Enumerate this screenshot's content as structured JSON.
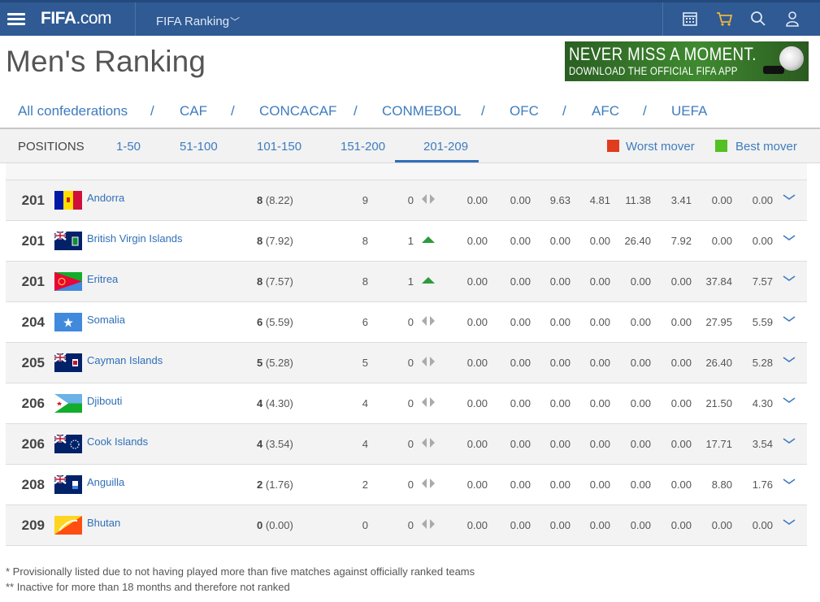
{
  "header": {
    "logo_main": "FIFA",
    "logo_suffix": ".com",
    "nav_title": "FIFA Ranking",
    "nav_chevron": "﹀"
  },
  "page_title": "Men's Ranking",
  "banner": {
    "line1": "NEVER MISS A MOMENT.",
    "line2": "DOWNLOAD THE OFFICIAL FIFA APP"
  },
  "confederations": [
    "All confederations",
    "CAF",
    "CONCACAF",
    "CONMEBOL",
    "OFC",
    "AFC",
    "UEFA"
  ],
  "positions_bar": {
    "label": "POSITIONS",
    "ranges": [
      "1-50",
      "51-100",
      "101-150",
      "151-200",
      "201-209"
    ],
    "active": "201-209",
    "worst_mover_label": "Worst mover",
    "best_mover_label": "Best mover",
    "worst_color": "#e03c1f",
    "best_color": "#54c022"
  },
  "rows": [
    {
      "rank": "201",
      "team": "Andorra",
      "pts": "8",
      "pts_exact": "(8.22)",
      "prev": "9",
      "move": "0",
      "trend": "same",
      "c1": "0.00",
      "c2": "0.00",
      "c3": "9.63",
      "c4": "4.81",
      "c5": "11.38",
      "c6": "3.41",
      "c7": "0.00",
      "c8": "0.00",
      "flag": "andorra"
    },
    {
      "rank": "201",
      "team": "British Virgin Islands",
      "pts": "8",
      "pts_exact": "(7.92)",
      "prev": "8",
      "move": "1",
      "trend": "up",
      "c1": "0.00",
      "c2": "0.00",
      "c3": "0.00",
      "c4": "0.00",
      "c5": "26.40",
      "c6": "7.92",
      "c7": "0.00",
      "c8": "0.00",
      "flag": "bvi"
    },
    {
      "rank": "201",
      "team": "Eritrea",
      "pts": "8",
      "pts_exact": "(7.57)",
      "prev": "8",
      "move": "1",
      "trend": "up",
      "c1": "0.00",
      "c2": "0.00",
      "c3": "0.00",
      "c4": "0.00",
      "c5": "0.00",
      "c6": "0.00",
      "c7": "37.84",
      "c8": "7.57",
      "flag": "eritrea"
    },
    {
      "rank": "204",
      "team": "Somalia",
      "pts": "6",
      "pts_exact": "(5.59)",
      "prev": "6",
      "move": "0",
      "trend": "same",
      "c1": "0.00",
      "c2": "0.00",
      "c3": "0.00",
      "c4": "0.00",
      "c5": "0.00",
      "c6": "0.00",
      "c7": "27.95",
      "c8": "5.59",
      "flag": "somalia"
    },
    {
      "rank": "205",
      "team": "Cayman Islands",
      "pts": "5",
      "pts_exact": "(5.28)",
      "prev": "5",
      "move": "0",
      "trend": "same",
      "c1": "0.00",
      "c2": "0.00",
      "c3": "0.00",
      "c4": "0.00",
      "c5": "0.00",
      "c6": "0.00",
      "c7": "26.40",
      "c8": "5.28",
      "flag": "cayman"
    },
    {
      "rank": "206",
      "team": "Djibouti",
      "pts": "4",
      "pts_exact": "(4.30)",
      "prev": "4",
      "move": "0",
      "trend": "same",
      "c1": "0.00",
      "c2": "0.00",
      "c3": "0.00",
      "c4": "0.00",
      "c5": "0.00",
      "c6": "0.00",
      "c7": "21.50",
      "c8": "4.30",
      "flag": "djibouti"
    },
    {
      "rank": "206",
      "team": "Cook Islands",
      "pts": "4",
      "pts_exact": "(3.54)",
      "prev": "4",
      "move": "0",
      "trend": "same",
      "c1": "0.00",
      "c2": "0.00",
      "c3": "0.00",
      "c4": "0.00",
      "c5": "0.00",
      "c6": "0.00",
      "c7": "17.71",
      "c8": "3.54",
      "flag": "cook"
    },
    {
      "rank": "208",
      "team": "Anguilla",
      "pts": "2",
      "pts_exact": "(1.76)",
      "prev": "2",
      "move": "0",
      "trend": "same",
      "c1": "0.00",
      "c2": "0.00",
      "c3": "0.00",
      "c4": "0.00",
      "c5": "0.00",
      "c6": "0.00",
      "c7": "8.80",
      "c8": "1.76",
      "flag": "anguilla"
    },
    {
      "rank": "209",
      "team": "Bhutan",
      "pts": "0",
      "pts_exact": "(0.00)",
      "prev": "0",
      "move": "0",
      "trend": "same",
      "c1": "0.00",
      "c2": "0.00",
      "c3": "0.00",
      "c4": "0.00",
      "c5": "0.00",
      "c6": "0.00",
      "c7": "0.00",
      "c8": "0.00",
      "flag": "bhutan"
    }
  ],
  "footnotes": [
    "* Provisionally listed due to not having played more than five matches against officially ranked teams",
    "** Inactive for more than 18 months and therefore not ranked"
  ]
}
